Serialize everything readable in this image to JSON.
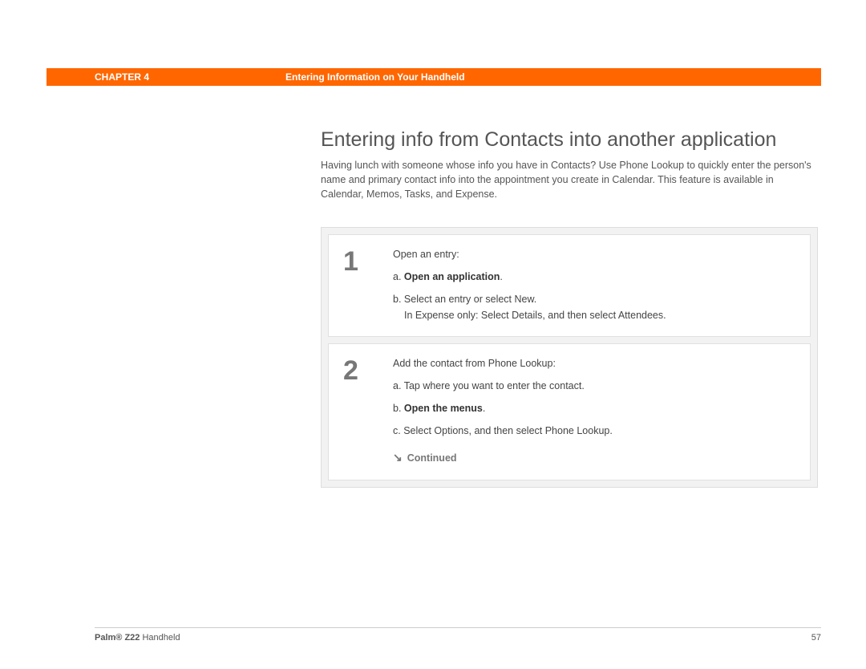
{
  "header": {
    "chapter_label": "CHAPTER 4",
    "chapter_title": "Entering Information on Your Handheld"
  },
  "main": {
    "title": "Entering info from Contacts into another application",
    "intro": "Having lunch with someone whose info you have in Contacts? Use Phone Lookup to quickly enter the person's name and primary contact info into the appointment you create in Calendar. This feature is available in Calendar, Memos, Tasks, and Expense.",
    "steps": [
      {
        "num": "1",
        "lead": "Open an entry:",
        "a_prefix": "a.",
        "a_link": "Open an application",
        "a_suffix": ".",
        "b_prefix": "b.",
        "b_text": "Select an entry or select New.",
        "b_extra": "In Expense only: Select Details, and then select Attendees."
      },
      {
        "num": "2",
        "lead": "Add the contact from Phone Lookup:",
        "a_prefix": "a.",
        "a_text": "Tap where you want to enter the contact.",
        "b_prefix": "b.",
        "b_link": "Open the menus",
        "b_suffix": ".",
        "c_prefix": "c.",
        "c_text": "Select Options, and then select Phone Lookup."
      }
    ],
    "continued": "Continued"
  },
  "footer": {
    "brand_bold": "Palm® Z22",
    "brand_rest": " Handheld",
    "page_number": "57"
  }
}
